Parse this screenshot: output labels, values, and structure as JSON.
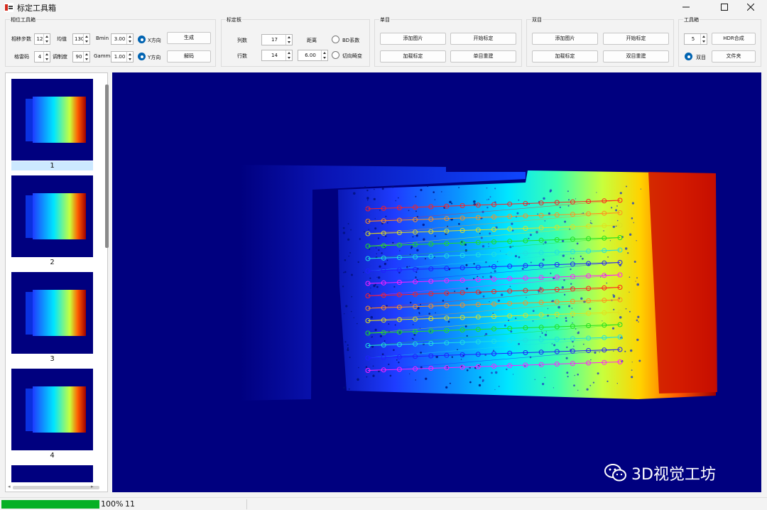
{
  "window": {
    "title": "标定工具箱",
    "icon_text": "标定",
    "minimize_icon": "minimize-icon",
    "maximize_icon": "maximize-icon",
    "close_icon": "close-icon"
  },
  "phase_group": {
    "title": "相位工具箱",
    "step_label": "相移步数",
    "step_value": "12",
    "mean_label": "均值",
    "mean_value": "130",
    "bmin_label": "Bmin",
    "bmin_value": "3.00",
    "x_dir_label": "X方向",
    "x_dir_checked": true,
    "generate_label": "生成",
    "gray_label": "格雷码",
    "gray_value": "4",
    "mod_label": "调制度",
    "mod_value": "90",
    "gamma_label": "Gamma",
    "gamma_value": "1.00",
    "y_dir_label": "Y方向",
    "y_dir_checked": true,
    "decode_label": "解码"
  },
  "board_group": {
    "title": "标定板",
    "cols_label": "列数",
    "cols_value": "17",
    "rows_label": "行数",
    "rows_value": "14",
    "dist_label": "距离",
    "dist_value": "6.00",
    "bd_label": "BD系数",
    "tangent_label": "切向畸变"
  },
  "mono_group": {
    "title": "单目",
    "add_image_label": "添加图片",
    "start_calib_label": "开始标定",
    "load_calib_label": "加载标定",
    "reconstruct_label": "单目重建"
  },
  "stereo_group": {
    "title": "双目",
    "add_image_label": "添加图片",
    "start_calib_label": "开始标定",
    "load_calib_label": "加载标定",
    "reconstruct_label": "双目重建"
  },
  "toolbox_group": {
    "title": "工具箱",
    "count_value": "5",
    "hdr_label": "HDR合成",
    "stereo_label": "双目",
    "stereo_checked": true,
    "folder_label": "文件夹"
  },
  "thumbnails": [
    {
      "label": "1",
      "selected": true
    },
    {
      "label": "2",
      "selected": false
    },
    {
      "label": "3",
      "selected": false
    },
    {
      "label": "4",
      "selected": false
    }
  ],
  "viewer": {
    "watermark_text": "3D视觉工坊",
    "watermark_icon": "wechat-icon",
    "grid_cols": 17,
    "grid_rows": 14
  },
  "status": {
    "progress_percent": 100,
    "percent_text": "100%",
    "count_text": "11"
  },
  "colors": {
    "background_blue": "#00007f",
    "progress_green": "#06b025",
    "radio_blue": "#0063b1",
    "selection_blue": "#cce8ff"
  }
}
